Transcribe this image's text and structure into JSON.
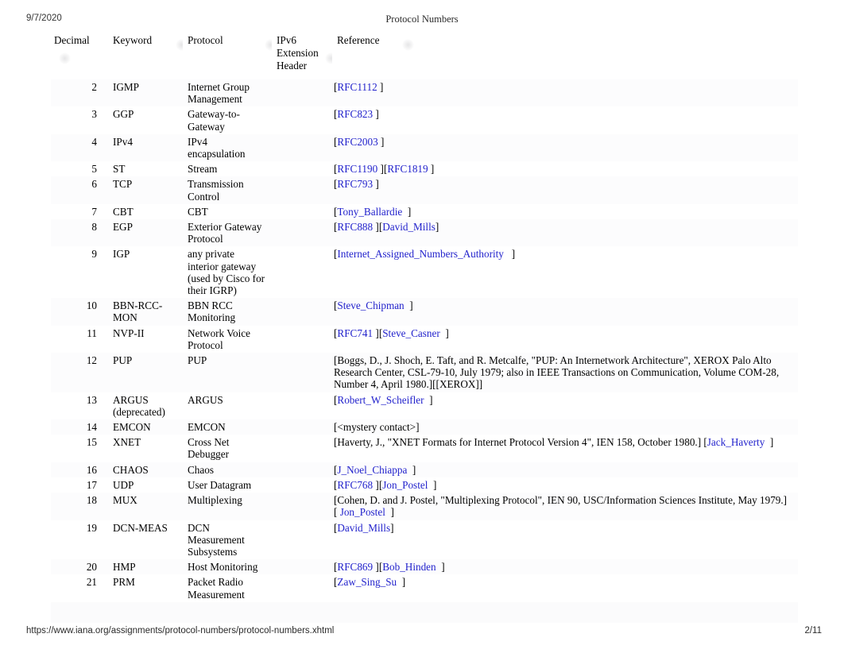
{
  "page": {
    "date": "9/7/2020",
    "title": "Protocol Numbers",
    "footer_url": "https://www.iana.org/assignments/protocol-numbers/protocol-numbers.xhtml",
    "page_number": "2/11",
    "link_color": "#2222cc"
  },
  "table": {
    "columns": [
      {
        "label": "Decimal",
        "sort_icon": "sort-icon"
      },
      {
        "label": "Keyword",
        "sort_icon": "sort-icon"
      },
      {
        "label": "Protocol",
        "sort_icon": "sort-icon"
      },
      {
        "label": "IPv6 Extension Header",
        "sort_icon": "sort-icon"
      },
      {
        "label": "Reference",
        "sort_icon": "sort-icon"
      }
    ],
    "rows": [
      {
        "decimal": "2",
        "keyword": "IGMP",
        "protocol": "Internet Group Management",
        "ipv6": "",
        "reference_parts": [
          {
            "t": "[",
            "link": false
          },
          {
            "t": "RFC1112",
            "link": true
          },
          {
            "t": " ]",
            "link": false
          }
        ]
      },
      {
        "decimal": "3",
        "keyword": "GGP",
        "protocol": "Gateway-to-Gateway",
        "ipv6": "",
        "reference_parts": [
          {
            "t": "[",
            "link": false
          },
          {
            "t": "RFC823",
            "link": true
          },
          {
            "t": " ]",
            "link": false
          }
        ]
      },
      {
        "decimal": "4",
        "keyword": "IPv4",
        "protocol": "IPv4 encapsulation",
        "ipv6": "",
        "reference_parts": [
          {
            "t": "[",
            "link": false
          },
          {
            "t": "RFC2003",
            "link": true
          },
          {
            "t": " ]",
            "link": false
          }
        ]
      },
      {
        "decimal": "5",
        "keyword": "ST",
        "protocol": "Stream",
        "ipv6": "",
        "reference_parts": [
          {
            "t": "[",
            "link": false
          },
          {
            "t": "RFC1190",
            "link": true
          },
          {
            "t": " ][",
            "link": false
          },
          {
            "t": "RFC1819",
            "link": true
          },
          {
            "t": " ]",
            "link": false
          }
        ]
      },
      {
        "decimal": "6",
        "keyword": "TCP",
        "protocol": "Transmission Control",
        "ipv6": "",
        "reference_parts": [
          {
            "t": "[",
            "link": false
          },
          {
            "t": "RFC793",
            "link": true
          },
          {
            "t": " ]",
            "link": false
          }
        ]
      },
      {
        "decimal": "7",
        "keyword": "CBT",
        "protocol": "CBT",
        "ipv6": "",
        "reference_parts": [
          {
            "t": "[",
            "link": false
          },
          {
            "t": "Tony_Ballardie",
            "link": true
          },
          {
            "t": "  ]",
            "link": false
          }
        ]
      },
      {
        "decimal": "8",
        "keyword": "EGP",
        "protocol": "Exterior Gateway Protocol",
        "ipv6": "",
        "reference_parts": [
          {
            "t": "[",
            "link": false
          },
          {
            "t": "RFC888",
            "link": true
          },
          {
            "t": " ][",
            "link": false
          },
          {
            "t": "David_Mills",
            "link": true
          },
          {
            "t": "]",
            "link": false
          }
        ]
      },
      {
        "decimal": "9",
        "keyword": "IGP",
        "protocol": "any private interior gateway (used by Cisco for their IGRP)",
        "ipv6": "",
        "reference_parts": [
          {
            "t": "[",
            "link": false
          },
          {
            "t": "Internet_Assigned_Numbers_Authority",
            "link": true
          },
          {
            "t": "   ]",
            "link": false
          }
        ]
      },
      {
        "decimal": "10",
        "keyword": "BBN-RCC-MON",
        "protocol": "BBN RCC Monitoring",
        "ipv6": "",
        "reference_parts": [
          {
            "t": "[",
            "link": false
          },
          {
            "t": "Steve_Chipman",
            "link": true
          },
          {
            "t": "  ]",
            "link": false
          }
        ]
      },
      {
        "decimal": "11",
        "keyword": "NVP-II",
        "protocol": "Network Voice Protocol",
        "ipv6": "",
        "reference_parts": [
          {
            "t": "[",
            "link": false
          },
          {
            "t": "RFC741",
            "link": true
          },
          {
            "t": " ][",
            "link": false
          },
          {
            "t": "Steve_Casner",
            "link": true
          },
          {
            "t": "  ]",
            "link": false
          }
        ]
      },
      {
        "decimal": "12",
        "keyword": "PUP",
        "protocol": "PUP",
        "ipv6": "",
        "reference_parts": [
          {
            "t": "[Boggs, D., J. Shoch, E. Taft, and R. Metcalfe, \"PUP: An Internetwork Architecture\", XEROX Palo Alto Research Center, CSL-79-10, July 1979; also in IEEE Transactions on Communication, Volume COM-28, Number 4, April 1980.][[XEROX]]",
            "link": false
          }
        ]
      },
      {
        "decimal": "13",
        "keyword": "ARGUS (deprecated)",
        "protocol": "ARGUS",
        "ipv6": "",
        "reference_parts": [
          {
            "t": "[",
            "link": false
          },
          {
            "t": "Robert_W_Scheifler",
            "link": true
          },
          {
            "t": "  ]",
            "link": false
          }
        ]
      },
      {
        "decimal": "14",
        "keyword": "EMCON",
        "protocol": "EMCON",
        "ipv6": "",
        "reference_parts": [
          {
            "t": "[<mystery contact>]",
            "link": false
          }
        ]
      },
      {
        "decimal": "15",
        "keyword": "XNET",
        "protocol": "Cross Net Debugger",
        "ipv6": "",
        "reference_parts": [
          {
            "t": "[Haverty, J., \"XNET Formats for Internet Protocol Version 4\", IEN 158, October 1980.] [",
            "link": false
          },
          {
            "t": "Jack_Haverty",
            "link": true
          },
          {
            "t": "  ]",
            "link": false
          }
        ]
      },
      {
        "decimal": "16",
        "keyword": "CHAOS",
        "protocol": "Chaos",
        "ipv6": "",
        "reference_parts": [
          {
            "t": "[",
            "link": false
          },
          {
            "t": "J_Noel_Chiappa",
            "link": true
          },
          {
            "t": "  ]",
            "link": false
          }
        ]
      },
      {
        "decimal": "17",
        "keyword": "UDP",
        "protocol": "User Datagram",
        "ipv6": "",
        "reference_parts": [
          {
            "t": "[",
            "link": false
          },
          {
            "t": "RFC768",
            "link": true
          },
          {
            "t": " ][",
            "link": false
          },
          {
            "t": "Jon_Postel",
            "link": true
          },
          {
            "t": "  ]",
            "link": false
          }
        ]
      },
      {
        "decimal": "18",
        "keyword": "MUX",
        "protocol": "Multiplexing",
        "ipv6": "",
        "reference_parts": [
          {
            "t": "[Cohen, D. and J. Postel, \"Multiplexing Protocol\", IEN 90, USC/Information Sciences Institute, May 1979.][ ",
            "link": false
          },
          {
            "t": "Jon_Postel",
            "link": true
          },
          {
            "t": "  ]",
            "link": false
          }
        ]
      },
      {
        "decimal": "19",
        "keyword": "DCN-MEAS",
        "protocol": "DCN Measurement Subsystems",
        "ipv6": "",
        "reference_parts": [
          {
            "t": "[",
            "link": false
          },
          {
            "t": "David_Mills",
            "link": true
          },
          {
            "t": "]",
            "link": false
          }
        ]
      },
      {
        "decimal": "20",
        "keyword": "HMP",
        "protocol": "Host Monitoring",
        "ipv6": "",
        "reference_parts": [
          {
            "t": "[",
            "link": false
          },
          {
            "t": "RFC869",
            "link": true
          },
          {
            "t": " ][",
            "link": false
          },
          {
            "t": "Bob_Hinden",
            "link": true
          },
          {
            "t": "  ]",
            "link": false
          }
        ]
      },
      {
        "decimal": "21",
        "keyword": "PRM",
        "protocol": "Packet Radio Measurement",
        "ipv6": "",
        "reference_parts": [
          {
            "t": "[",
            "link": false
          },
          {
            "t": "Zaw_Sing_Su",
            "link": true
          },
          {
            "t": "  ]",
            "link": false
          }
        ]
      }
    ]
  }
}
